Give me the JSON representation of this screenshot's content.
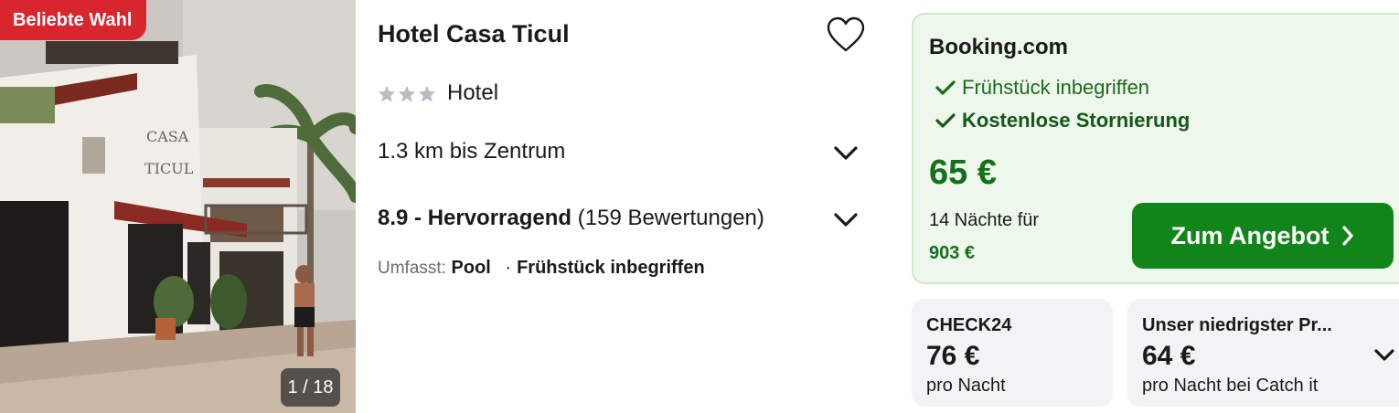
{
  "image": {
    "badge": "Beliebte Wahl",
    "counter": "1 / 18",
    "photo_sign": [
      "CASA",
      "TICUL"
    ]
  },
  "hotel": {
    "name": "Hotel Casa Ticul",
    "stars": 3,
    "type": "Hotel",
    "distance": "1.3 km bis Zentrum",
    "rating_score": "8.9 - Hervorragend",
    "rating_reviews": "(159 Bewertungen)",
    "amenities_label": "Umfasst:",
    "amenities": [
      "Pool",
      "Frühstück inbegriffen"
    ]
  },
  "deal": {
    "provider": "Booking.com",
    "features": [
      "Frühstück inbegriffen",
      "Kostenlose Stornierung"
    ],
    "price": "65 €",
    "nights": "14 Nächte für",
    "total": "903 €",
    "cta": "Zum Angebot"
  },
  "offers": [
    {
      "provider": "CHECK24",
      "price": "76 €",
      "sub": "pro Nacht"
    },
    {
      "provider": "Unser niedrigster Pr...",
      "price": "64 €",
      "sub": "pro Nacht bei Catch it"
    }
  ],
  "colors": {
    "badge": "#d8262f",
    "deal_bg": "#eef7ec",
    "deal_green": "#15701c",
    "cta": "#12851a",
    "offer_bg": "#f2f3f5",
    "star": "#b9bcc3"
  }
}
